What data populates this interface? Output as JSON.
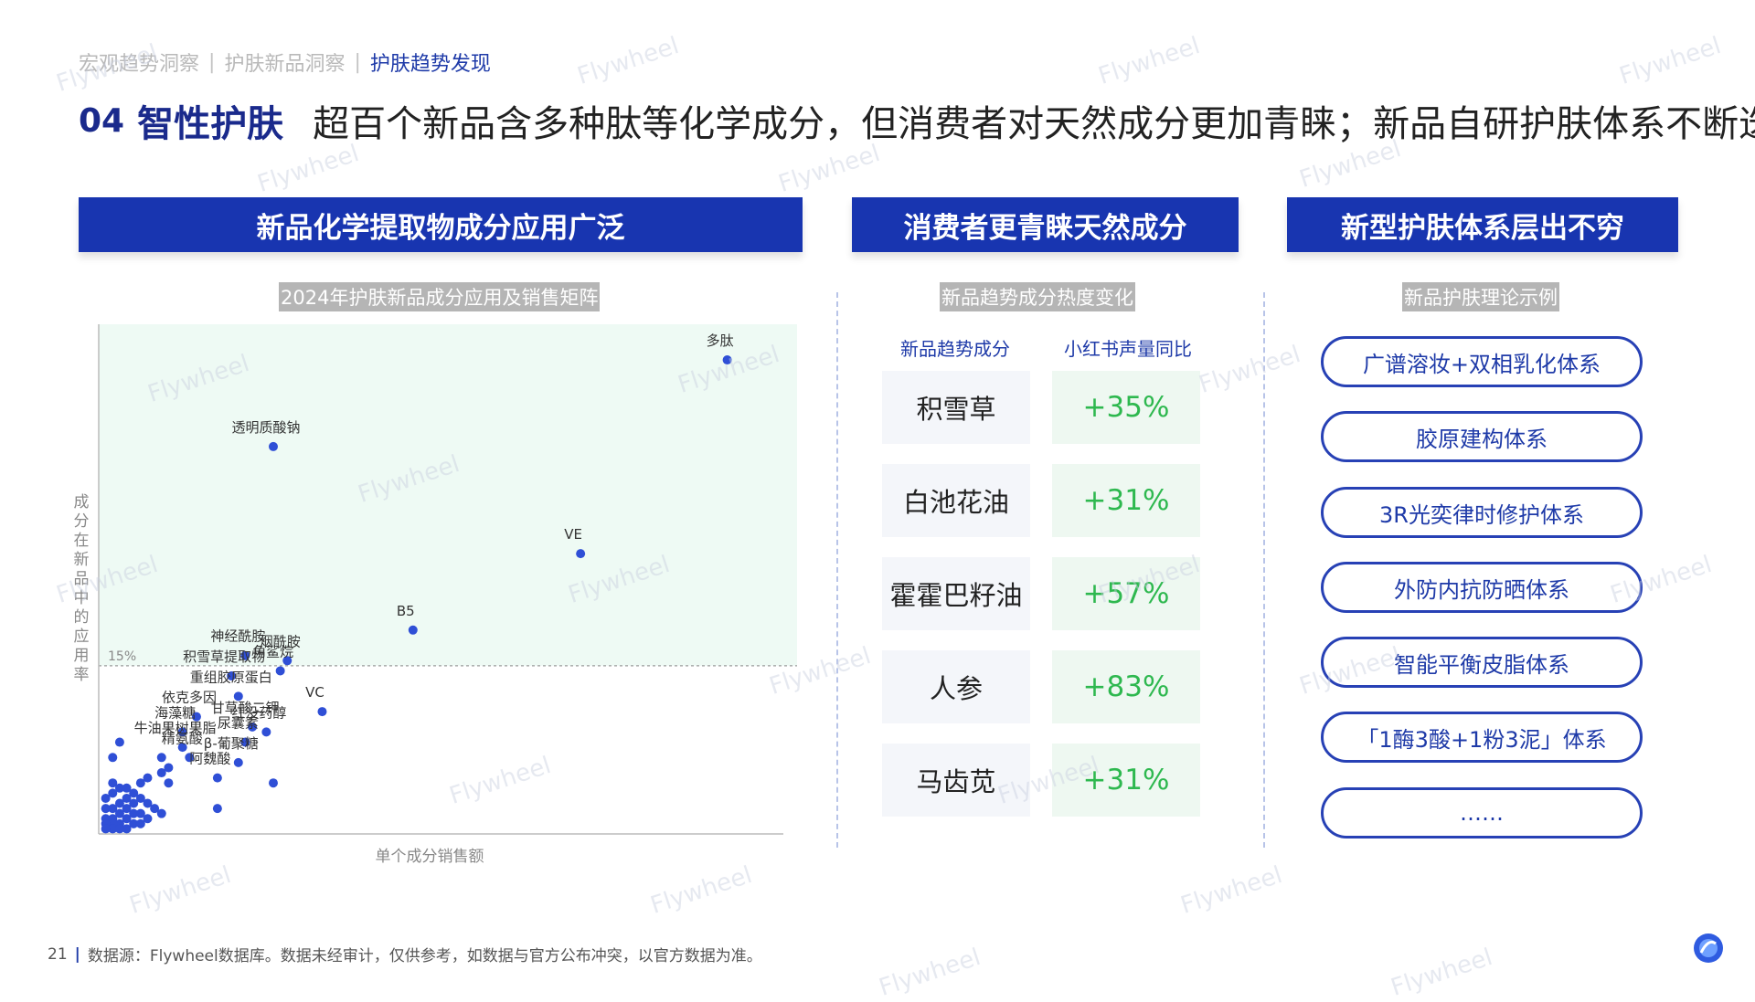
{
  "breadcrumb": [
    "宏观趋势洞察",
    "护肤新品洞察",
    "护肤趋势发现"
  ],
  "title": {
    "num": "04",
    "topic": "智性护肤",
    "main": "超百个新品含多种肽等化学成分，但消费者对天然成分更加青睐；新品自研护肤体系不断迭代"
  },
  "sections": [
    {
      "header": "新品化学提取物成分应用广泛",
      "subtitle": "2024年护肤新品成分应用及销售矩阵"
    },
    {
      "header": "消费者更青睐天然成分",
      "subtitle": "新品趋势成分热度变化"
    },
    {
      "header": "新型护肤体系层出不穷",
      "subtitle": "新品护肤理论示例"
    }
  ],
  "chart_data": {
    "type": "scatter",
    "xlabel": "单个成分销售额",
    "ylabel": "成分在新品中的应用率",
    "reference_line": {
      "y_label": "15%"
    },
    "xlim": [
      0,
      100
    ],
    "ylim": [
      0,
      100
    ],
    "labeled_points": [
      {
        "label": "多肽",
        "x": 90,
        "y": 93
      },
      {
        "label": "透明质酸钠",
        "x": 25,
        "y": 76
      },
      {
        "label": "VE",
        "x": 69,
        "y": 55
      },
      {
        "label": "B5",
        "x": 45,
        "y": 40
      },
      {
        "label": "神经酰胺",
        "x": 21,
        "y": 35
      },
      {
        "label": "积雪草提取物",
        "x": 19,
        "y": 31
      },
      {
        "label": "烟酰胺",
        "x": 27,
        "y": 34
      },
      {
        "label": "角鲨烷",
        "x": 26,
        "y": 32
      },
      {
        "label": "重组胶原蛋白",
        "x": 20,
        "y": 27
      },
      {
        "label": "VC",
        "x": 32,
        "y": 24
      },
      {
        "label": "依克多因",
        "x": 14,
        "y": 23
      },
      {
        "label": "海藻糖",
        "x": 12,
        "y": 20
      },
      {
        "label": "甘草酸二钾",
        "x": 22,
        "y": 21
      },
      {
        "label": "红没药醇",
        "x": 24,
        "y": 20
      },
      {
        "label": "尿囊素",
        "x": 21,
        "y": 18
      },
      {
        "label": "牛油果树果脂",
        "x": 12,
        "y": 17
      },
      {
        "label": "精氨酸",
        "x": 13,
        "y": 15
      },
      {
        "label": "β-葡聚糖",
        "x": 20,
        "y": 14
      },
      {
        "label": "阿魏酸",
        "x": 17,
        "y": 11
      },
      {
        "label": "",
        "x": 25,
        "y": 10
      },
      {
        "label": "",
        "x": 17,
        "y": 5
      }
    ],
    "cluster_points": [
      {
        "x": 3,
        "y": 18
      },
      {
        "x": 2,
        "y": 15
      },
      {
        "x": 9,
        "y": 15
      },
      {
        "x": 10,
        "y": 13
      },
      {
        "x": 9,
        "y": 12
      },
      {
        "x": 7,
        "y": 11
      },
      {
        "x": 10,
        "y": 10
      },
      {
        "x": 6,
        "y": 10
      },
      {
        "x": 2,
        "y": 10
      },
      {
        "x": 3,
        "y": 9
      },
      {
        "x": 4,
        "y": 9
      },
      {
        "x": 5,
        "y": 8
      },
      {
        "x": 2,
        "y": 8
      },
      {
        "x": 4,
        "y": 7
      },
      {
        "x": 6,
        "y": 7
      },
      {
        "x": 1,
        "y": 7
      },
      {
        "x": 3,
        "y": 6
      },
      {
        "x": 5,
        "y": 6
      },
      {
        "x": 7,
        "y": 6
      },
      {
        "x": 2,
        "y": 5
      },
      {
        "x": 4,
        "y": 5
      },
      {
        "x": 1,
        "y": 5
      },
      {
        "x": 3,
        "y": 4
      },
      {
        "x": 6,
        "y": 4
      },
      {
        "x": 8,
        "y": 5
      },
      {
        "x": 2,
        "y": 3
      },
      {
        "x": 4,
        "y": 3
      },
      {
        "x": 1,
        "y": 3
      },
      {
        "x": 3,
        "y": 2
      },
      {
        "x": 5,
        "y": 2
      },
      {
        "x": 2,
        "y": 2
      },
      {
        "x": 6,
        "y": 2
      },
      {
        "x": 1,
        "y": 2
      },
      {
        "x": 4,
        "y": 1
      },
      {
        "x": 2,
        "y": 1
      },
      {
        "x": 3,
        "y": 1
      },
      {
        "x": 7,
        "y": 3
      },
      {
        "x": 9,
        "y": 4
      },
      {
        "x": 5,
        "y": 4
      },
      {
        "x": 1,
        "y": 1
      }
    ],
    "colors": {
      "point": "#2f4fd6",
      "highlight_area": "#eefaf4",
      "reference": "#999999"
    }
  },
  "trend_table": {
    "col1": "新品趋势成分",
    "col2": "小红书声量同比",
    "rows": [
      {
        "ingredient": "积雪草",
        "change": "+35%"
      },
      {
        "ingredient": "白池花油",
        "change": "+31%"
      },
      {
        "ingredient": "霍霍巴籽油",
        "change": "+57%"
      },
      {
        "ingredient": "人参",
        "change": "+83%"
      },
      {
        "ingredient": "马齿苋",
        "change": "+31%"
      }
    ]
  },
  "systems": [
    "广谱溶妆+双相乳化体系",
    "胶原建构体系",
    "3R光奕律时修护体系",
    "外防内抗防晒体系",
    "智能平衡皮脂体系",
    "「1酶3酸+1粉3泥」体系",
    "……"
  ],
  "footer": {
    "page": "21",
    "source": "数据源：Flywheel数据库。数据未经审计，仅供参考，如数据与官方公布冲突，以官方数据为准。"
  },
  "watermark": "Flywheel",
  "colors": {
    "primary": "#1835b0",
    "accent_green": "#2eb84f"
  }
}
